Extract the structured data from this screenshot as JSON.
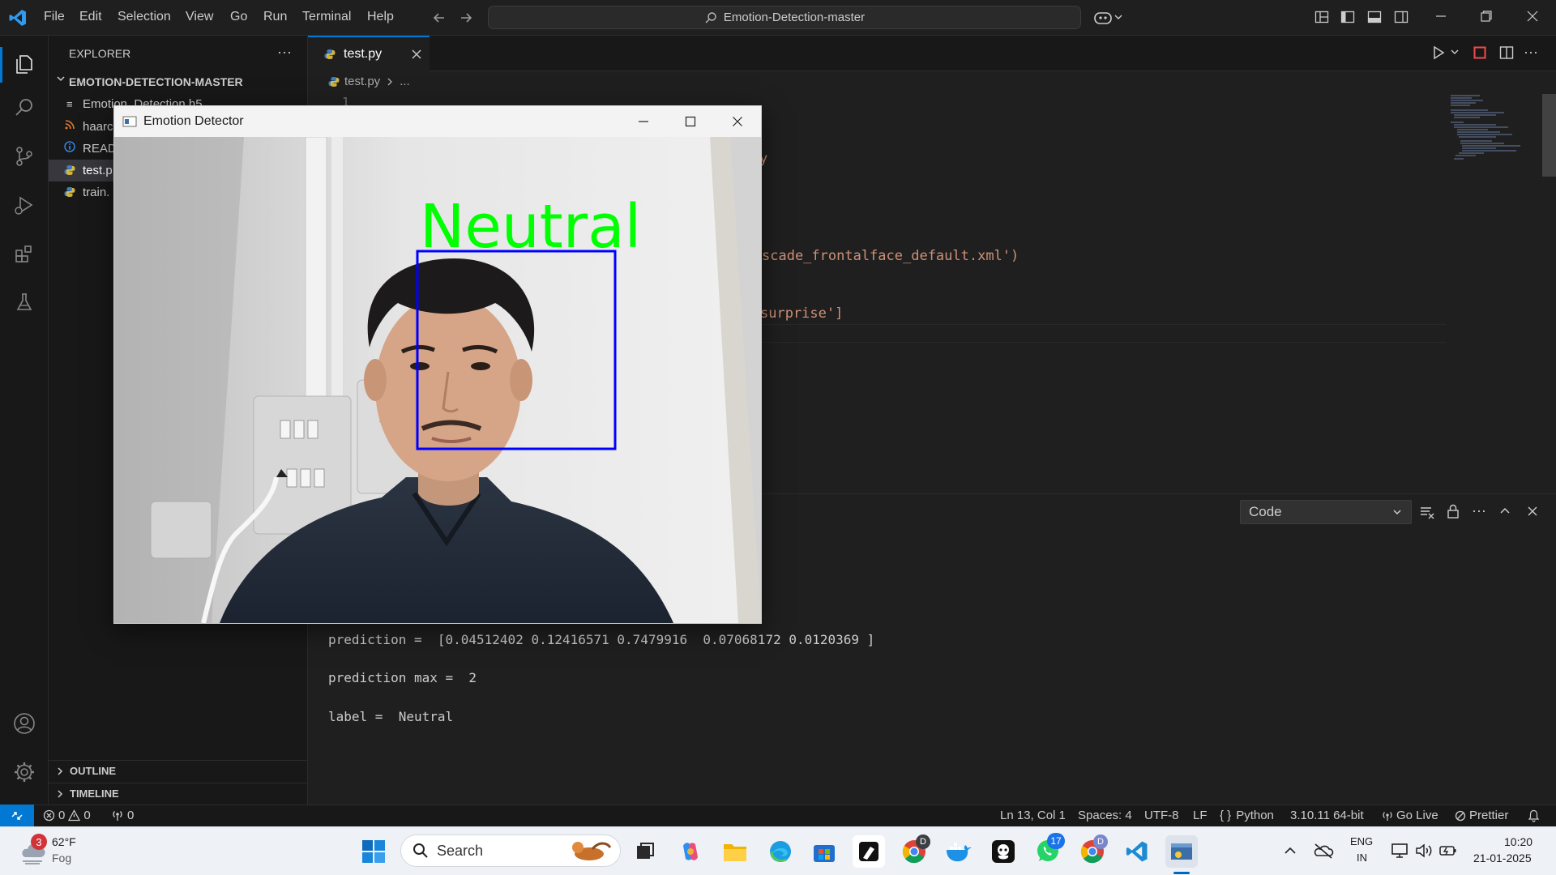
{
  "colors": {
    "accent": "#0078d4",
    "editor_bg": "#1f1f1f",
    "side_bg": "#181818",
    "detect_label": "#00ff00",
    "face_box": "#0000ff",
    "string_color": "#ce9178"
  },
  "titlebar": {
    "menu": [
      "File",
      "Edit",
      "Selection",
      "View",
      "Go",
      "Run",
      "Terminal",
      "Help"
    ],
    "search_text": "Emotion-Detection-master"
  },
  "explorer": {
    "header": "EXPLORER",
    "folder": "EMOTION-DETECTION-MASTER",
    "files": [
      {
        "name": "Emotion_Detection.h5",
        "icon": "lines-icon"
      },
      {
        "name": "haarc",
        "icon": "rss-icon"
      },
      {
        "name": "READ",
        "icon": "info-icon"
      },
      {
        "name": "test.p",
        "icon": "python-icon"
      },
      {
        "name": "train.",
        "icon": "python-icon"
      }
    ],
    "outline": "OUTLINE",
    "timeline": "TIMELINE"
  },
  "editor": {
    "tab": "test.py",
    "breadcrumb_file": "test.py",
    "breadcrumb_rest": "...",
    "line_number": "1",
    "code_fragments": [
      "y",
      "scade_frontalface_default.xml')",
      "surprise']"
    ]
  },
  "panel": {
    "dropdown": "Code",
    "output": [
      "prediction =  [0.04512402 0.12416571 0.7479916  0.07068172 0.0120369 ]",
      "prediction max =  2",
      "label =  Neutral"
    ]
  },
  "statusbar": {
    "errors": "0",
    "warnings": "0",
    "ports": "0",
    "position": "Ln 13, Col 1",
    "spaces": "Spaces: 4",
    "encoding": "UTF-8",
    "eol": "LF",
    "language": "Python",
    "interpreter": "3.10.11 64-bit",
    "golive": "Go Live",
    "prettier": "Prettier"
  },
  "popup": {
    "title": "Emotion Detector",
    "detect_label": "Neutral"
  },
  "taskbar": {
    "weather_badge": "3",
    "temperature": "62°F",
    "condition": "Fog",
    "search_label": "Search",
    "chrome_badge": "D",
    "whatsapp_badge": "17",
    "lang_top": "ENG",
    "lang_bottom": "IN",
    "time": "10:20",
    "date": "21-01-2025"
  }
}
